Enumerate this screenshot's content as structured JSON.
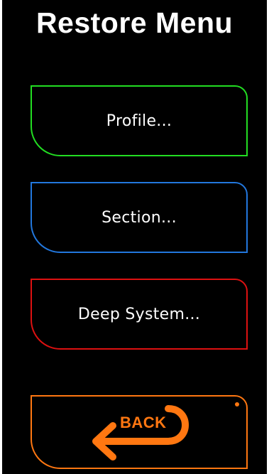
{
  "screen": {
    "title": "Restore Menu"
  },
  "buttons": {
    "profile": {
      "label": "Profile...",
      "color": "#22dd22"
    },
    "section": {
      "label": "Section...",
      "color": "#2277dd"
    },
    "deep_system": {
      "label": "Deep System...",
      "color": "#dd1111"
    },
    "back": {
      "label": "BACK",
      "color": "#ff7711",
      "icon": "return-arrow-icon"
    }
  },
  "colors": {
    "background": "#000000",
    "text": "#ffffff"
  }
}
